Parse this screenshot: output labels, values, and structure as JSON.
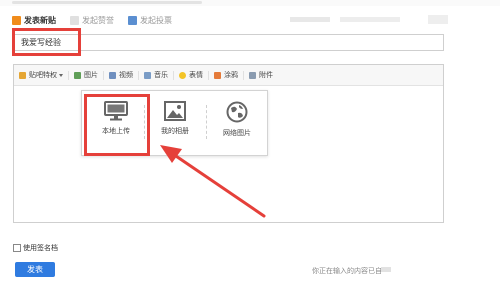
{
  "tabs": [
    {
      "label": "发表新贴",
      "icon": "new-post-icon",
      "active": true
    },
    {
      "label": "发起赞誉",
      "icon": "praise-icon",
      "active": false
    },
    {
      "label": "发起投票",
      "icon": "poll-icon",
      "active": false
    }
  ],
  "title_input": {
    "value": "我爱写经验"
  },
  "toolbar": {
    "tag": "贴吧特权",
    "image": "图片",
    "video": "视频",
    "music": "音乐",
    "emoji": "表情",
    "draw": "涂鸦",
    "attach": "附件"
  },
  "image_popup": {
    "local_upload": "本地上传",
    "my_album": "我的相册",
    "web_image": "网络图片"
  },
  "signature": {
    "label": "使用签名档",
    "checked": false
  },
  "submit_label": "发表",
  "hint_text": "你正在输入的内容已自",
  "colors": {
    "annotation_red": "#e5403a",
    "primary_blue": "#2f7be0"
  }
}
